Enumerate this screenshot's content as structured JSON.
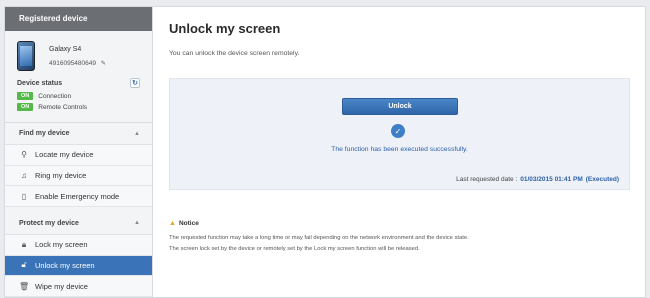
{
  "sidebar": {
    "header": "Registered device",
    "device": {
      "name": "Galaxy S4",
      "id": "4916095480649"
    },
    "status": {
      "title": "Device status",
      "items": [
        {
          "badge": "ON",
          "label": "Connection"
        },
        {
          "badge": "ON",
          "label": "Remote Controls"
        }
      ]
    },
    "sections": [
      {
        "title": "Find my device",
        "items": [
          {
            "label": "Locate my device",
            "icon": "magnifier-icon"
          },
          {
            "label": "Ring my device",
            "icon": "music-note-icon"
          },
          {
            "label": "Enable Emergency mode",
            "icon": "phone-icon"
          }
        ]
      },
      {
        "title": "Protect my device",
        "items": [
          {
            "label": "Lock my screen",
            "icon": "lock-icon"
          },
          {
            "label": "Unlock my screen",
            "icon": "unlock-icon",
            "active": true
          },
          {
            "label": "Wipe my device",
            "icon": "trash-icon"
          }
        ]
      }
    ]
  },
  "main": {
    "title": "Unlock my screen",
    "subtitle": "You can unlock the device screen remotely.",
    "unlock_button": "Unlock",
    "success_message": "The function has been executed successfully.",
    "last_requested_label": "Last requested date :",
    "last_requested_date": "01/03/2015 01:41 PM",
    "last_requested_status": "(Executed)",
    "notice": {
      "title": "Notice",
      "lines": [
        "The requested function may take a long time or may fail depending on the network environment and the device state.",
        "The screen lock set by the device or remotely set by the Lock my screen function will be released."
      ]
    }
  },
  "colors": {
    "accent": "#3a73b8",
    "on_badge": "#55b94a",
    "link": "#2c5fa8"
  }
}
